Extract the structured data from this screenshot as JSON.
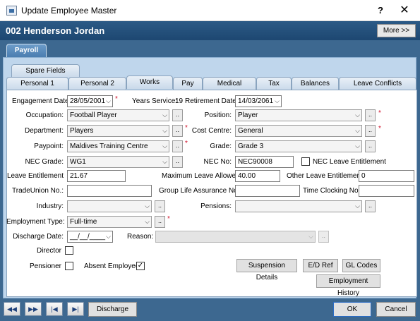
{
  "window": {
    "title": "Update Employee Master",
    "help": "?",
    "close": "✕"
  },
  "header": {
    "employee": "002 Henderson Jordan",
    "more": "More >>"
  },
  "tabs_top": {
    "payroll": "Payroll"
  },
  "tabs": {
    "spare_fields": "Spare Fields",
    "personal1": "Personal 1",
    "personal2": "Personal 2",
    "works": "Works",
    "pay": "Pay",
    "medical": "Medical",
    "tax": "Tax",
    "balances": "Balances",
    "leave_conflicts": "Leave Conflicts"
  },
  "form": {
    "engagement_date_label": "Engagement Date:",
    "engagement_date": "28/05/2001",
    "years_service_label": "Years Service:",
    "years_service": "19",
    "retirement_date_label": "Retirement Date:",
    "retirement_date": "14/03/2061",
    "occupation_label": "Occupation:",
    "occupation": "Football Player",
    "position_label": "Position:",
    "position": "Player",
    "department_label": "Department:",
    "department": "Players",
    "cost_centre_label": "Cost Centre:",
    "cost_centre": "General",
    "paypoint_label": "Paypoint:",
    "paypoint": "Maldives Training Centre",
    "grade_label": "Grade:",
    "grade": "Grade 3",
    "nec_grade_label": "NEC Grade:",
    "nec_grade": "WG1",
    "nec_no_label": "NEC No:",
    "nec_no": "NEC90008",
    "nec_leave_label": "NEC Leave Entitlement",
    "leave_ent_label": "Leave Entitlement",
    "leave_ent": "21.67",
    "max_leave_label": "Maximum Leave Allowed:",
    "max_leave": "40.00",
    "other_leave_label": "Other Leave Entitlement:",
    "other_leave": "0",
    "trade_union_label": "TradeUnion No.:",
    "trade_union": "",
    "group_life_label": "Group Life Assurance No.",
    "group_life": "",
    "time_clock_label": "Time Clocking No.:",
    "time_clock": "",
    "industry_label": "Industry:",
    "industry": "",
    "pensions_label": "Pensions:",
    "pensions": "",
    "emp_type_label": "Employment Type:",
    "emp_type": "Full-time",
    "discharge_label": "Discharge Date:",
    "discharge": "__/__/____",
    "reason_label": "Reason:",
    "reason": "",
    "director_label": "Director",
    "pensioner_label": "Pensioner",
    "absent_label": "Absent Employee",
    "dots": "..",
    "req": "*",
    "dd": "⌵"
  },
  "buttons": {
    "suspension": "Suspension Details",
    "ed_ref": "E/D Ref",
    "gl_codes": "GL Codes",
    "employment_history": "Employment History",
    "discharge": "Discharge",
    "ok": "OK",
    "cancel": "Cancel"
  },
  "nav": {
    "first": "◀◀",
    "next": "▶▶",
    "begin": "|◀",
    "end": "▶|"
  }
}
